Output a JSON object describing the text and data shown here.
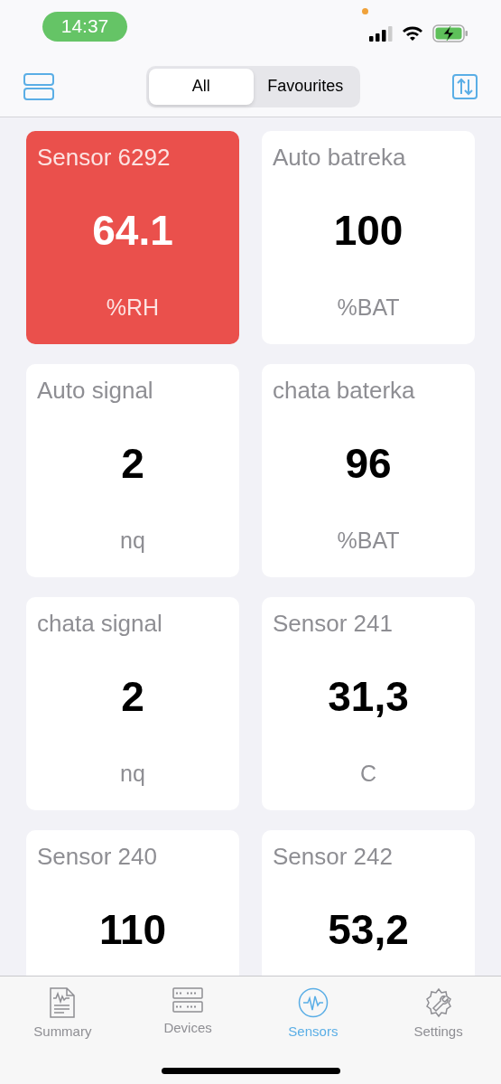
{
  "status_bar": {
    "time": "14:37"
  },
  "segments": [
    {
      "label": "All",
      "selected": true
    },
    {
      "label": "Favourites",
      "selected": false
    }
  ],
  "sensors": [
    {
      "name": "Sensor 6292",
      "value": "64.1",
      "unit": "%RH",
      "alert": true
    },
    {
      "name": "Auto batreka",
      "value": "100",
      "unit": "%BAT",
      "alert": false
    },
    {
      "name": "Auto signal",
      "value": "2",
      "unit": "nq",
      "alert": false
    },
    {
      "name": "chata baterka",
      "value": "96",
      "unit": "%BAT",
      "alert": false
    },
    {
      "name": "chata signal",
      "value": "2",
      "unit": "nq",
      "alert": false
    },
    {
      "name": "Sensor 241",
      "value": "31,3",
      "unit": "C",
      "alert": false
    },
    {
      "name": "Sensor 240",
      "value": "110",
      "alert": false
    },
    {
      "name": "Sensor 242",
      "value": "53,2",
      "alert": false
    }
  ],
  "tab_bar": [
    {
      "label": "Summary",
      "kind": "summary",
      "selected": false
    },
    {
      "label": "Devices",
      "kind": "devices",
      "selected": false
    },
    {
      "label": "Sensors",
      "kind": "sensors",
      "selected": true
    },
    {
      "label": "Settings",
      "kind": "settings",
      "selected": false
    }
  ]
}
